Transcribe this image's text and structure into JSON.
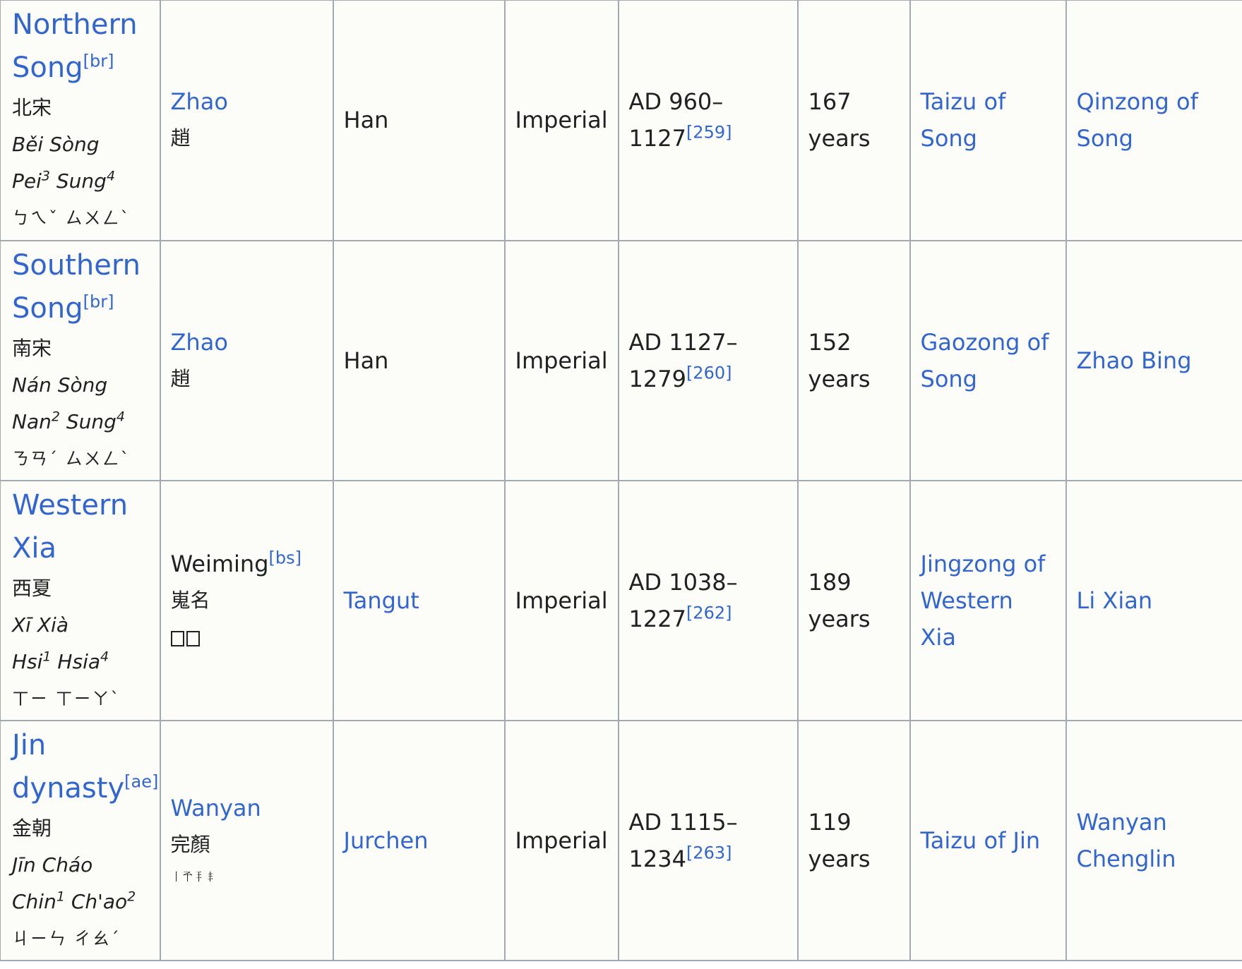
{
  "rows": [
    {
      "dynasty": {
        "name_a": "Northern",
        "name_b": "Song",
        "note": "[br]",
        "chinese": "北宋",
        "pinyin": "Běi Sòng",
        "wg1": "Pei",
        "wg1_tone": "3",
        "wg2": "Sung",
        "wg2_tone": "4",
        "zhuyin": "ㄅㄟˇ ㄙㄨㄥˋ"
      },
      "ruling_house": {
        "name": "Zhao",
        "chinese": "趙"
      },
      "ethnicity": "Han",
      "title": "Imperial",
      "period": {
        "line1": "AD 960–",
        "line2": "1127",
        "ref": "[259]"
      },
      "duration": {
        "number": "167",
        "unit": "years"
      },
      "founder": {
        "line1": "Taizu of",
        "line2": "Song"
      },
      "last": {
        "line1": "Qinzong of",
        "line2": "Song"
      }
    },
    {
      "dynasty": {
        "name_a": "Southern",
        "name_b": "Song",
        "note": "[br]",
        "chinese": "南宋",
        "pinyin": "Nán Sòng",
        "wg1": "Nan",
        "wg1_tone": "2",
        "wg2": "Sung",
        "wg2_tone": "4",
        "zhuyin": "ㄋㄢˊ ㄙㄨㄥˋ"
      },
      "ruling_house": {
        "name": "Zhao",
        "chinese": "趙"
      },
      "ethnicity": "Han",
      "title": "Imperial",
      "period": {
        "line1": "AD 1127–",
        "line2": "1279",
        "ref": "[260]"
      },
      "duration": {
        "number": "152",
        "unit": "years"
      },
      "founder": {
        "line1": "Gaozong of",
        "line2": "Song"
      },
      "last": {
        "line1": "Zhao Bing",
        "line2": ""
      }
    },
    {
      "dynasty": {
        "name_a": "Western",
        "name_b": "Xia",
        "note": "",
        "chinese": "西夏",
        "pinyin": "Xī Xià",
        "wg1": "Hsi",
        "wg1_tone": "1",
        "wg2": "Hsia",
        "wg2_tone": "4",
        "zhuyin": "ㄒㄧ ㄒㄧㄚˋ"
      },
      "ruling_house": {
        "name": "Weiming",
        "note": "[bs]",
        "chinese": "嵬名"
      },
      "ethnicity": "Tangut",
      "title": "Imperial",
      "period": {
        "line1": "AD 1038–",
        "line2": "1227",
        "ref": "[262]"
      },
      "duration": {
        "number": "189",
        "unit": "years"
      },
      "founder": {
        "line1": "Jingzong of",
        "line2": "Western Xia"
      },
      "last": {
        "line1": "Li Xian",
        "line2": ""
      }
    },
    {
      "dynasty": {
        "name_a": "Jin",
        "name_b": "dynasty",
        "note": "[ae]",
        "chinese": "金朝",
        "pinyin": "Jīn Cháo",
        "wg1": "Chin",
        "wg1_tone": "1",
        "wg2": "Ch'ao",
        "wg2_tone": "2",
        "zhuyin": "ㄐㄧㄣ ㄔㄠˊ"
      },
      "ruling_house": {
        "name": "Wanyan",
        "chinese": "完顏",
        "script": "𘠁𘡚𘡠𘡡"
      },
      "ethnicity": "Jurchen",
      "title": "Imperial",
      "period": {
        "line1": "AD 1115–",
        "line2": "1234",
        "ref": "[263]"
      },
      "duration": {
        "number": "119",
        "unit": "years"
      },
      "founder": {
        "line1": "Taizu of Jin",
        "line2": ""
      },
      "last": {
        "line1": "Wanyan",
        "line2": "Chenglin"
      }
    }
  ],
  "colors": {
    "link": "#3366cc",
    "border": "#a2a9b1",
    "cell_bg": "#fcfcf9",
    "text": "#202122"
  }
}
